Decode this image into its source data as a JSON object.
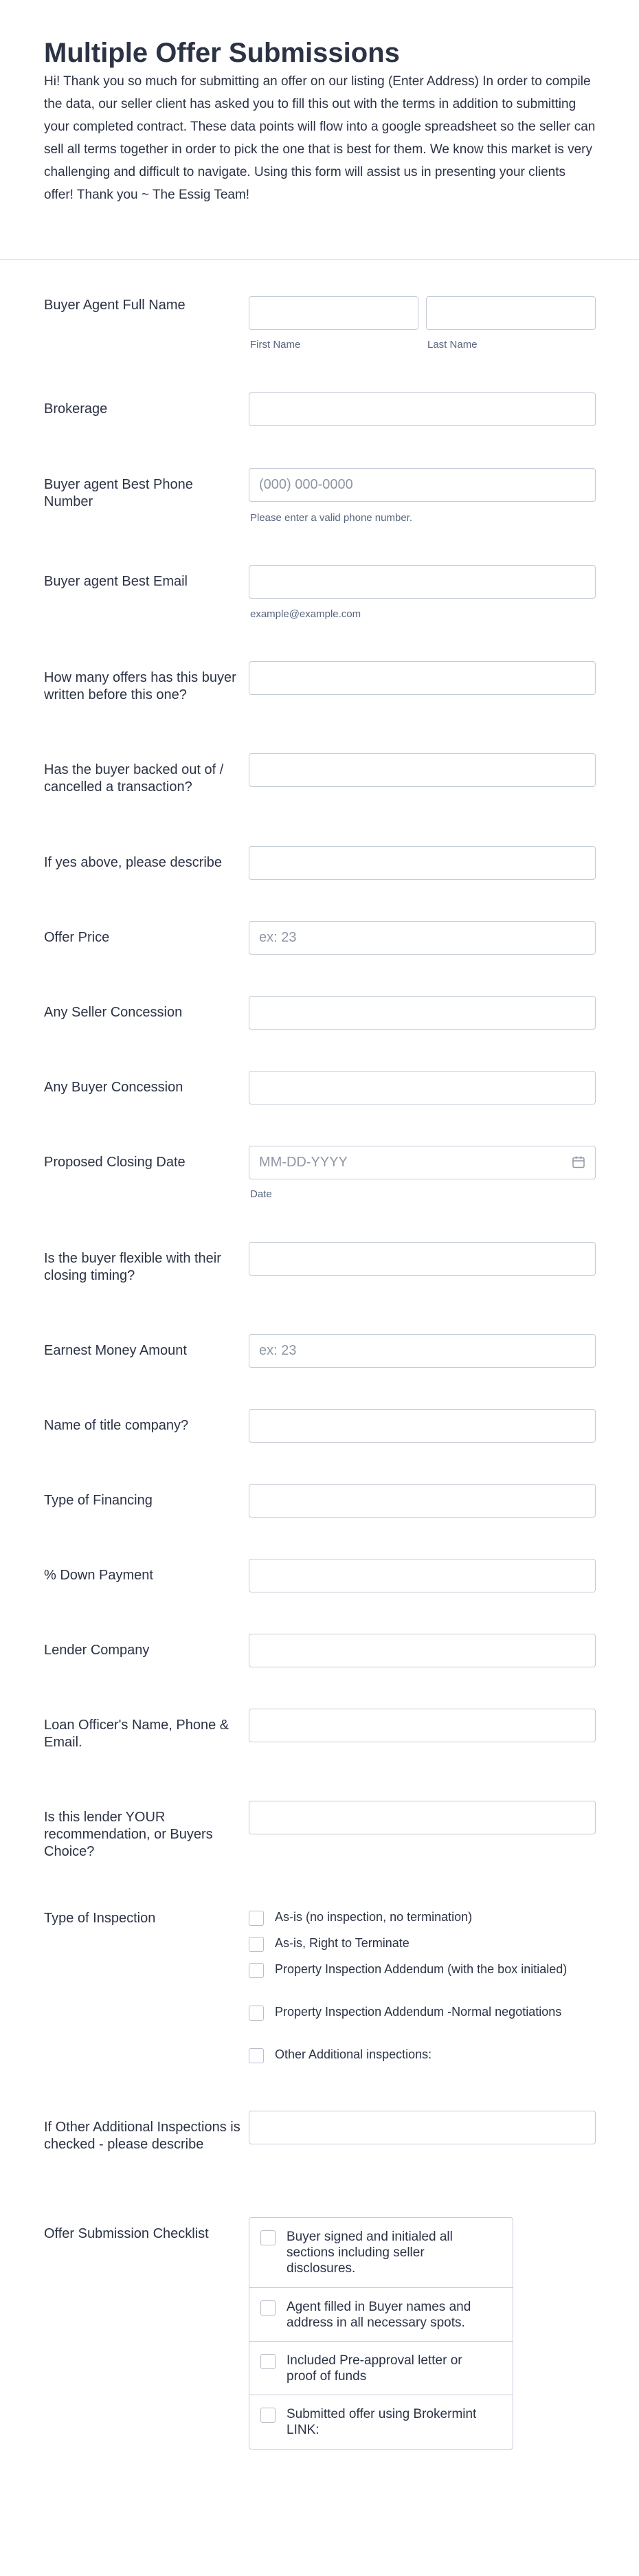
{
  "header": {
    "title": "Multiple Offer Submissions",
    "description": "Hi! Thank you so much for submitting an offer on our listing (Enter Address) In order to compile the data, our seller client has asked you to fill this out with the terms in addition to submitting your completed contract. These data points will flow into a google spreadsheet so the seller can sell all terms together in order to pick the one that is best for them. We know this market is very challenging and difficult to navigate. Using this form will assist us in presenting your clients offer! Thank you ~ The Essig Team!"
  },
  "fields": {
    "buyer_agent_name": {
      "label": "Buyer Agent Full Name",
      "first_sublabel": "First Name",
      "last_sublabel": "Last Name"
    },
    "brokerage": {
      "label": "Brokerage"
    },
    "phone": {
      "label": "Buyer agent Best Phone Number",
      "placeholder": "(000) 000-0000",
      "sublabel": "Please enter a valid phone number."
    },
    "email": {
      "label": "Buyer agent Best Email",
      "sublabel": "example@example.com"
    },
    "offers_written": {
      "label": "How many offers has this buyer written before this one?"
    },
    "backed_out": {
      "label": "Has the buyer backed out of / cancelled a transaction?"
    },
    "if_yes": {
      "label": "If yes above, please describe"
    },
    "offer_price": {
      "label": "Offer Price",
      "placeholder": "ex: 23"
    },
    "seller_concession": {
      "label": "Any Seller Concession"
    },
    "buyer_concession": {
      "label": "Any Buyer Concession"
    },
    "closing_date": {
      "label": "Proposed Closing Date",
      "placeholder": "MM-DD-YYYY",
      "sublabel": "Date",
      "icon": "calendar-icon"
    },
    "flexible_timing": {
      "label": "Is the buyer flexible with their closing timing?"
    },
    "earnest_money": {
      "label": "Earnest Money Amount",
      "placeholder": "ex: 23"
    },
    "title_company": {
      "label": "Name of title company?"
    },
    "financing": {
      "label": "Type of Financing"
    },
    "down_payment": {
      "label": "% Down Payment"
    },
    "lender_company": {
      "label": "Lender Company"
    },
    "loan_officer": {
      "label": "Loan Officer's Name, Phone & Email."
    },
    "lender_rec": {
      "label": "Is this lender YOUR recommendation, or Buyers Choice?"
    },
    "inspection": {
      "label": "Type of Inspection",
      "options": [
        "As-is (no inspection, no termination)",
        "As-is, Right to Terminate",
        "Property Inspection Addendum (with the box initialed)",
        "Property Inspection Addendum -Normal negotiations",
        "Other Additional inspections:"
      ]
    },
    "other_inspections": {
      "label": "If Other Additional Inspections is checked - please describe"
    },
    "checklist": {
      "label": "Offer Submission Checklist",
      "items": [
        "Buyer signed and initialed all sections including seller disclosures.",
        "Agent filled in Buyer names and address in all necessary spots.",
        "Included Pre-approval letter or proof of funds",
        "Submitted offer using Brokermint LINK:"
      ]
    }
  }
}
